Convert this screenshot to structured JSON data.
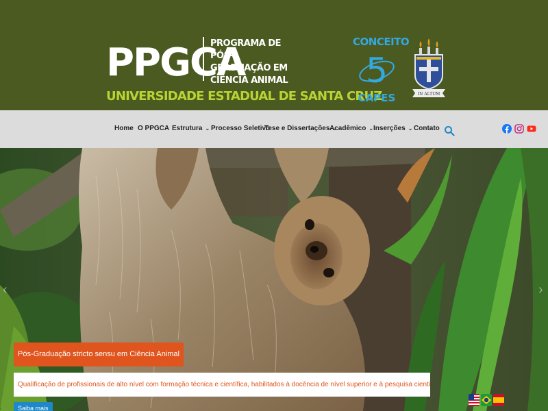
{
  "header": {
    "logo_short": "PPGCA",
    "program_lines": [
      "PROGRAMA DE",
      "PÓS-GRADUAÇÃO EM",
      "CIÊNCIA ANIMAL"
    ],
    "university": "UNIVERSIDADE ESTADUAL DE SANTA CRUZ",
    "capes": {
      "top": "CONCEITO",
      "grade": "5",
      "bottom": "CAPES"
    },
    "crest_motto": "IN ALTUM"
  },
  "nav": {
    "items": [
      {
        "label": "Home",
        "dropdown": false
      },
      {
        "label": "O PPGCA",
        "dropdown": false
      },
      {
        "label": "Estrutura",
        "dropdown": true
      },
      {
        "label": "Processo Seletivo",
        "dropdown": false
      },
      {
        "label": "Tese e Dissertações",
        "dropdown": true
      },
      {
        "label": "Acadêmico",
        "dropdown": true
      },
      {
        "label": "Inserções",
        "dropdown": true
      },
      {
        "label": "Contato",
        "dropdown": false
      }
    ],
    "caret": "⌄",
    "search_icon": "search-icon",
    "social_icons": [
      "facebook-icon",
      "instagram-icon",
      "youtube-icon"
    ]
  },
  "hero": {
    "caption_title": "Pós-Graduação stricto sensu em Ciência Animal",
    "caption_text": "Qualificação de profissionais de alto nível com formação técnica e científica, habilitados à docência de nível superior e à pesquisa científica na área de Ciência Animal.",
    "button_label": "Saiba mais",
    "arrow_left": "‹",
    "arrow_right": "›"
  },
  "languages": [
    "English",
    "Português",
    "Español"
  ],
  "colors": {
    "header_bg": "#4a5a21",
    "university_text": "#b8d433",
    "capes_blue": "#35a8e0",
    "nav_bg": "#dcdcdc",
    "accent_orange": "#e0541d",
    "button_blue": "#1e88c8",
    "search_blue": "#1e88c8"
  }
}
